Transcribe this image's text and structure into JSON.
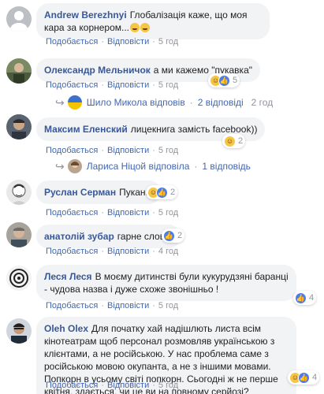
{
  "comments": [
    {
      "author": "Andrew Berezhnyi",
      "text": "Глобалізація каже, що моя кара за корнером...",
      "emoji_count": 2,
      "like": "Подобається",
      "reply": "Відповісти",
      "time": "5 год"
    },
    {
      "author": "Олександр Мельничок",
      "text": "а ми кажемо \"пукавка\"",
      "like": "Подобається",
      "reply": "Відповісти",
      "time": "5 год",
      "reactions_count": "5",
      "replies": {
        "name": "Шило Микола",
        "verb": "відповів",
        "count": "2 відповіді",
        "time": "2 год"
      }
    },
    {
      "author": "Максим Еленский",
      "text": "лицекнига замість facebook))",
      "like": "Подобається",
      "reply": "Відповісти",
      "time": "5 год",
      "reactions_count": "2",
      "replies": {
        "name": "Лариса Ніцой",
        "verb": "відповіла",
        "count": "1 відповідь"
      }
    },
    {
      "author": "Руслан Серман",
      "text": "Пуканці",
      "like": "Подобається",
      "reply": "Відповісти",
      "time": "5 год",
      "reactions_count": "2"
    },
    {
      "author": "анатолій зубар",
      "text": "гарне слово.",
      "like": "Подобається",
      "reply": "Відповісти",
      "time": "4 год",
      "reactions_count": "2"
    },
    {
      "author": "Леся Леся",
      "text": "В моєму дитинстві були кукурудзяні баранці - чудова назва і дуже схоже звонішньо !",
      "like": "Подобається",
      "reply": "Відповісти",
      "time": "5 год",
      "reactions_count": "4"
    },
    {
      "author": "Oleh Olex",
      "text": "Для початку хай надішлють листа всім кінотеатрам щоб персонал розмовляв українською з клієнтами, а не російською. У нас проблема саме з російською мовою окупанта, а не з іншими мовами. Попкорн в усьому світі попкорн. Сьогодні ж не перше квітня, здається, чи це ви на повному серйозі?",
      "like": "Подобається",
      "reply": "Відповісти",
      "time": "5 год",
      "reactions_count": "4"
    }
  ],
  "colors": {
    "link": "#385898",
    "bubble": "#f2f3f5",
    "meta": "#90949c"
  }
}
